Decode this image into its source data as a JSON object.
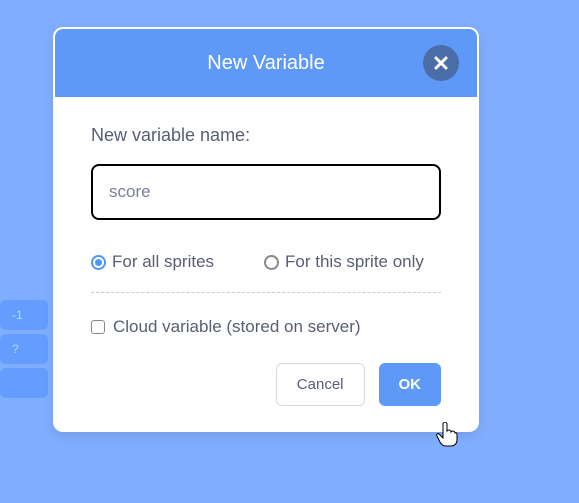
{
  "dialog": {
    "title": "New Variable",
    "field_label": "New variable name:",
    "input_value": "score",
    "radios": {
      "all_sprites_label": "For all sprites",
      "this_sprite_label": "For this sprite only",
      "selected": "all_sprites"
    },
    "cloud_checkbox_label": "Cloud variable (stored on server)",
    "cloud_checked": false,
    "buttons": {
      "cancel": "Cancel",
      "ok": "OK"
    }
  },
  "colors": {
    "primary": "#5f99f8",
    "text": "#575e75",
    "bg": "#80aeff"
  }
}
